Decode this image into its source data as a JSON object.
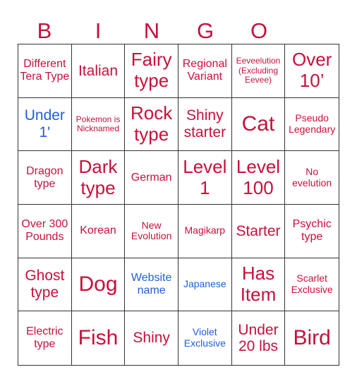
{
  "header": {
    "letters": [
      "B",
      "I",
      "N",
      "G",
      "O"
    ]
  },
  "colors": {
    "primary": "#c8103a",
    "secondary": "#1f5fd9",
    "grid_line": "#333333"
  },
  "grid": {
    "rows": [
      [
        {
          "text": "Different Tera Type",
          "color": "primary"
        },
        {
          "text": "Italian",
          "color": "primary"
        },
        {
          "text": "Fairy type",
          "color": "primary"
        },
        {
          "text": "Regional Variant",
          "color": "primary"
        },
        {
          "text": "Eeveelution (Excluding Eevee)",
          "color": "primary"
        },
        {
          "text": "Over 10’",
          "color": "primary"
        }
      ],
      [
        {
          "text": "Under 1'",
          "color": "secondary"
        },
        {
          "text": "Pokemon is Nicknamed",
          "color": "primary"
        },
        {
          "text": "Rock type",
          "color": "primary"
        },
        {
          "text": "Shiny starter",
          "color": "primary"
        },
        {
          "text": "Cat",
          "color": "primary"
        },
        {
          "text": "Pseudo Legendary",
          "color": "primary"
        }
      ],
      [
        {
          "text": "Dragon type",
          "color": "primary"
        },
        {
          "text": "Dark type",
          "color": "primary"
        },
        {
          "text": "German",
          "color": "primary"
        },
        {
          "text": "Level 1",
          "color": "primary"
        },
        {
          "text": "Level 100",
          "color": "primary"
        },
        {
          "text": "No evelution",
          "color": "primary"
        }
      ],
      [
        {
          "text": "Over 300 Pounds",
          "color": "primary"
        },
        {
          "text": "Korean",
          "color": "primary"
        },
        {
          "text": "New Evolution",
          "color": "primary"
        },
        {
          "text": "Magikarp",
          "color": "primary"
        },
        {
          "text": "Starter",
          "color": "primary"
        },
        {
          "text": "Psychic type",
          "color": "primary"
        }
      ],
      [
        {
          "text": "Ghost type",
          "color": "primary"
        },
        {
          "text": "Dog",
          "color": "primary"
        },
        {
          "text": "Website name",
          "color": "secondary"
        },
        {
          "text": "Japanese",
          "color": "secondary"
        },
        {
          "text": "Has Item",
          "color": "primary"
        },
        {
          "text": "Scarlet Exclusive",
          "color": "primary"
        }
      ],
      [
        {
          "text": "Electric type",
          "color": "primary"
        },
        {
          "text": "Fish",
          "color": "primary"
        },
        {
          "text": "Shiny",
          "color": "primary"
        },
        {
          "text": "Violet Exclusive",
          "color": "secondary"
        },
        {
          "text": "Under 20 lbs",
          "color": "primary"
        },
        {
          "text": "Bird",
          "color": "primary"
        }
      ]
    ]
  }
}
